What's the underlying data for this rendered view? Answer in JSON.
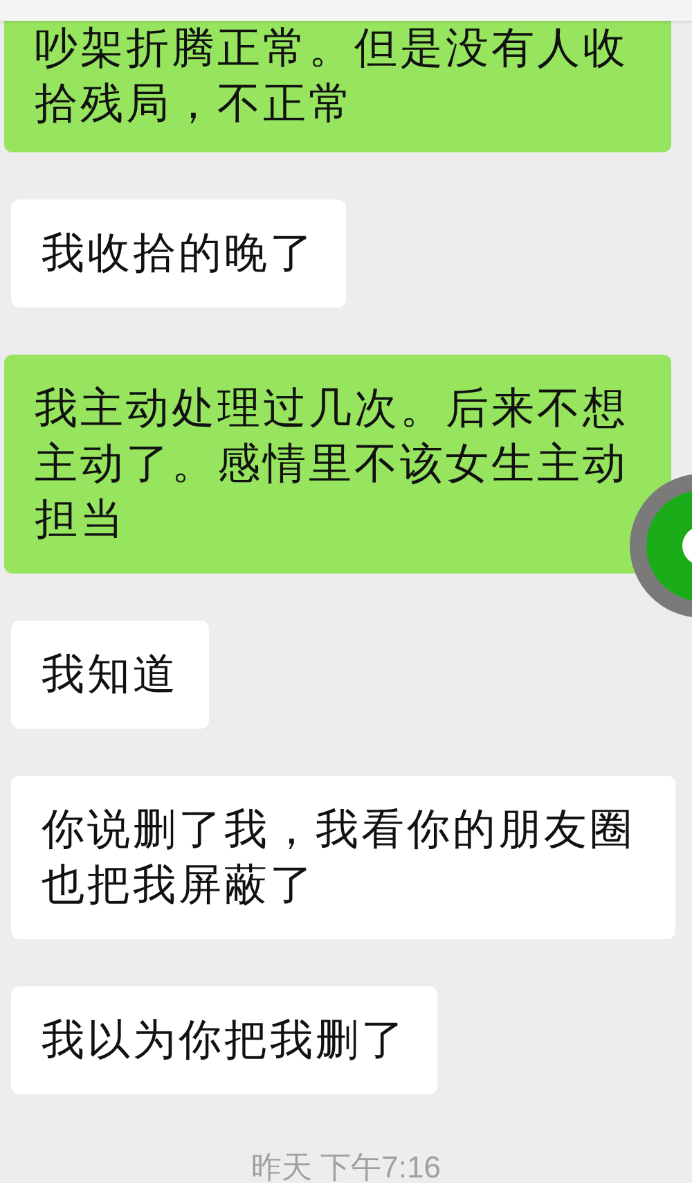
{
  "messages": [
    {
      "kind": "sent",
      "text": "吵架折腾正常。但是没有人收拾残局，不正常"
    },
    {
      "kind": "received",
      "text": "我收拾的晚了"
    },
    {
      "kind": "sent",
      "text": "我主动处理过几次。后来不想主动了。感情里不该女生主动担当"
    },
    {
      "kind": "received",
      "text": "我知道"
    },
    {
      "kind": "received",
      "text": "你说删了我，我看你的朋友圈也把我屏蔽了"
    },
    {
      "kind": "received",
      "text": "我以为你把我删了"
    }
  ],
  "timestamp": "昨天 下午7:16"
}
